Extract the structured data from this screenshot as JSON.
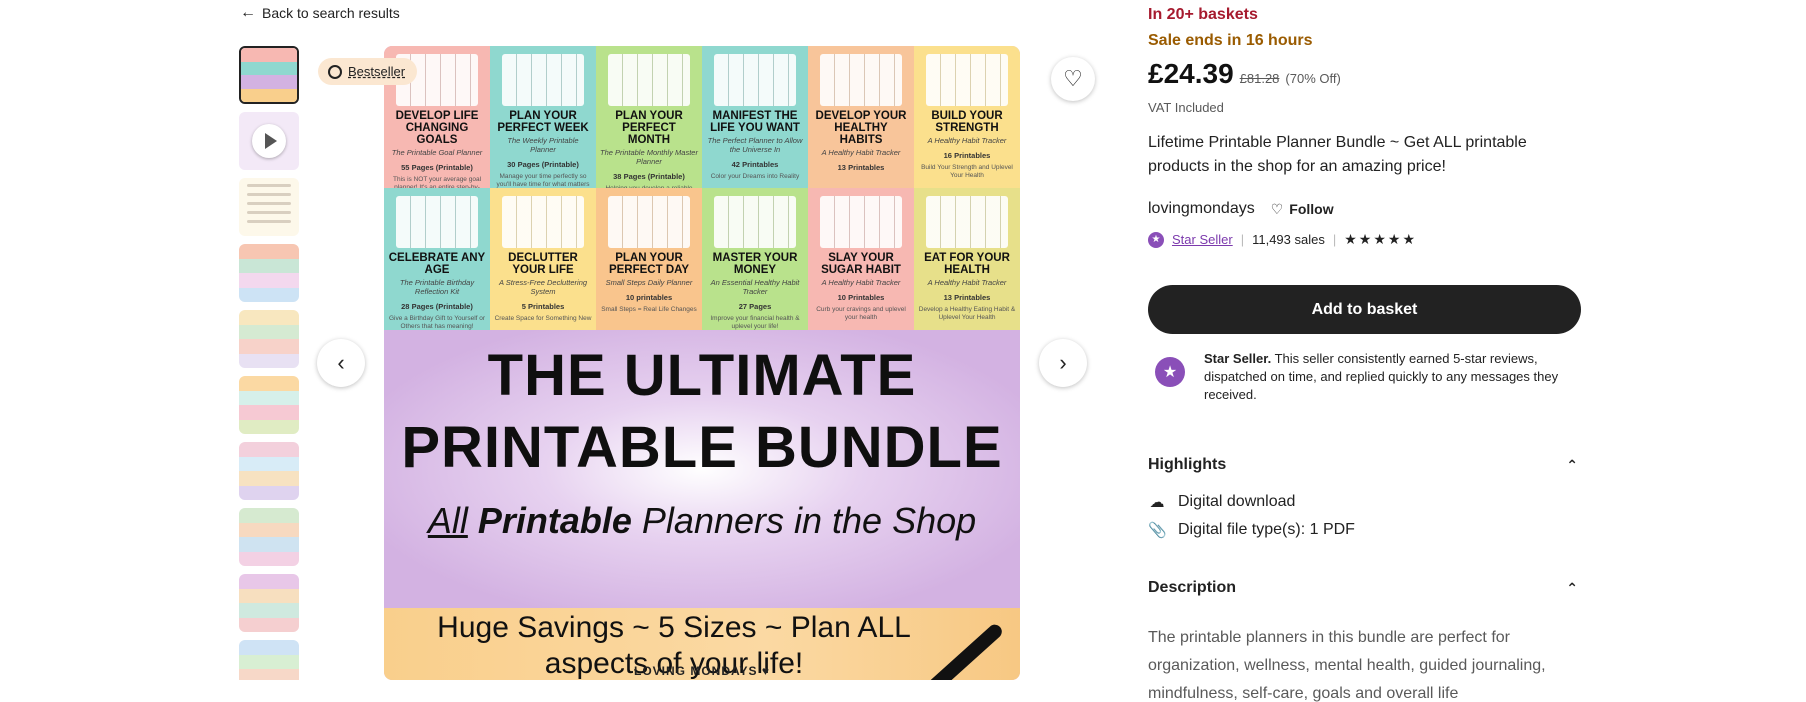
{
  "nav": {
    "back_label": "Back to search results"
  },
  "gallery": {
    "badge": "Bestseller",
    "thumb_count": 10,
    "tiles": [
      {
        "title": "DEVELOP LIFE CHANGING GOALS",
        "sub": "The Printable Goal Planner",
        "pages": "55 Pages (Printable)",
        "desc": "This is NOT your average goal planner! It's an entire step-by-step process providing meaning and clarity.",
        "color": "#f7b8b2"
      },
      {
        "title": "PLAN YOUR PERFECT WEEK",
        "sub": "The Weekly Printable Planner",
        "pages": "30 Pages (Printable)",
        "desc": "Manage your time perfectly so you'll have time for what matters",
        "color": "#8fd8cf"
      },
      {
        "title": "PLAN YOUR PERFECT MONTH",
        "sub": "The Printable Monthly Master Planner",
        "pages": "38 Pages (Printable)",
        "desc": "Helping you develop a reliable structure for monthly reflection, planning and growth.",
        "color": "#b9e28c"
      },
      {
        "title": "MANIFEST THE LIFE YOU WANT",
        "sub": "The Perfect Planner to Allow the Universe In",
        "pages": "42 Printables",
        "desc": "Color your Dreams into Reality",
        "color": "#8fd8cf"
      },
      {
        "title": "DEVELOP YOUR HEALTHY HABITS",
        "sub": "A Healthy Habit Tracker",
        "pages": "13 Printables",
        "desc": "",
        "color": "#f8c59a"
      },
      {
        "title": "BUILD YOUR STRENGTH",
        "sub": "A Healthy Habit Tracker",
        "pages": "16 Printables",
        "desc": "Build Your Strength and Uplevel Your Health",
        "color": "#fbe08d"
      },
      {
        "title": "CELEBRATE ANY AGE",
        "sub": "The Printable Birthday Reflection Kit",
        "pages": "28 Pages (Printable)",
        "desc": "Give a Birthday Gift to Yourself or Others that has meaning!",
        "color": "#8fd8cf"
      },
      {
        "title": "DECLUTTER YOUR LIFE",
        "sub": "A Stress-Free Decluttering System",
        "pages": "5 Printables",
        "desc": "Create Space for Something New",
        "color": "#fbe08d"
      },
      {
        "title": "PLAN YOUR PERFECT DAY",
        "sub": "Small Steps Daily Planner",
        "pages": "10 printables",
        "desc": "Small Steps = Real Life Changes",
        "color": "#f9c58d"
      },
      {
        "title": "MASTER YOUR MONEY",
        "sub": "An Essential Healthy Habit Tracker",
        "pages": "27 Pages",
        "desc": "Improve your financial health & uplevel your life!",
        "color": "#b9e28c"
      },
      {
        "title": "SLAY YOUR SUGAR HABIT",
        "sub": "A Healthy Habit Tracker",
        "pages": "10 Printables",
        "desc": "Curb your cravings and uplevel your health",
        "color": "#f7b8b2"
      },
      {
        "title": "EAT FOR YOUR HEALTH",
        "sub": "A Healthy Habit Tracker",
        "pages": "13 Printables",
        "desc": "Develop a Healthy Eating Habit & Uplevel Your Health",
        "color": "#e7e08a"
      }
    ],
    "banner_line1": "THE ULTIMATE",
    "banner_line2": "PRINTABLE BUNDLE",
    "tagline_all": "All",
    "tagline_printable": "Printable",
    "tagline_rest": "Planners in the Shop",
    "promo": "Huge Savings ~ 5 Sizes ~ Plan ALL aspects of your life!",
    "brand": "LOVING MONDAYS ♥"
  },
  "listing": {
    "in_baskets": "In 20+ baskets",
    "sale": "Sale ends in 16 hours",
    "price": "£24.39",
    "old_price": "£81.28",
    "discount": "(70% Off)",
    "vat": "VAT Included",
    "title": "Lifetime Printable Planner Bundle ~ Get ALL printable products in the shop for an amazing price!",
    "shop": "lovingmondays",
    "follow": "Follow",
    "star_seller": "Star Seller",
    "sales": "11,493 sales",
    "stars": "★★★★★",
    "add_to_basket": "Add to basket",
    "star_seller_heading": "Star Seller.",
    "star_seller_text": "This seller consistently earned 5-star reviews, dispatched on time, and replied quickly to any messages they received.",
    "highlights_heading": "Highlights",
    "highlight_1": "Digital download",
    "highlight_2": "Digital file type(s): 1 PDF",
    "description_heading": "Description",
    "description": "The printable planners in this bundle are perfect for organization, wellness, mental health, guided journaling, mindfulness, self-care, goals and overall life"
  }
}
